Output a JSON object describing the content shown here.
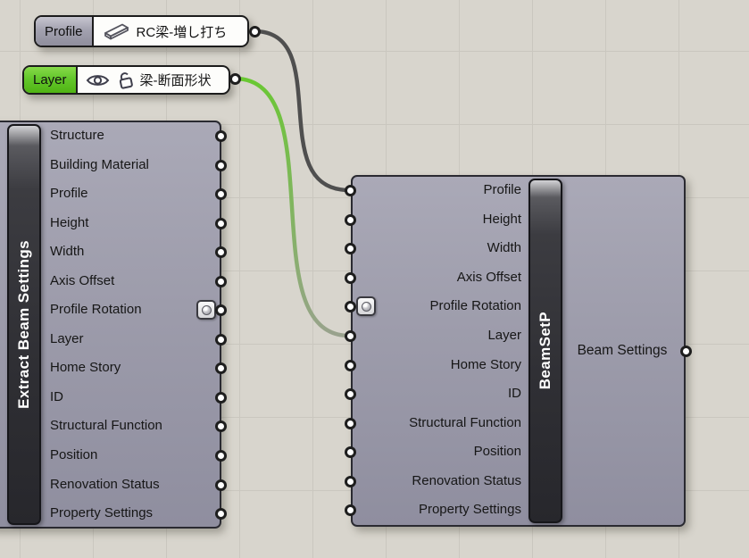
{
  "canvas": {
    "background": "#d8d5cd",
    "grid_line": "#cac7bf"
  },
  "params": {
    "profile": {
      "label": "Profile",
      "value": "RC梁-増し打ち"
    },
    "layer": {
      "label": "Layer",
      "value": "梁-断面形状",
      "selected_color": "#5eb718"
    }
  },
  "components": {
    "extract": {
      "name": "Extract Beam Settings",
      "outputs": [
        "Structure",
        "Building Material",
        "Profile",
        "Height",
        "Width",
        "Axis Offset",
        "Profile Rotation",
        "Layer",
        "Home Story",
        "ID",
        "Structural Function",
        "Position",
        "Renovation Status",
        "Property Settings"
      ]
    },
    "beamsetp": {
      "name": "BeamSetP",
      "inputs": [
        "Profile",
        "Height",
        "Width",
        "Axis Offset",
        "Profile Rotation",
        "Layer",
        "Home Story",
        "ID",
        "Structural Function",
        "Position",
        "Renovation Status",
        "Property Settings"
      ],
      "output_label": "Beam Settings"
    }
  },
  "wires": [
    {
      "name": "profile-wire",
      "from": "Profile param output",
      "to": "BeamSetP Profile input",
      "color": "#4f4f4f"
    },
    {
      "name": "layer-wire",
      "from": "Layer param output",
      "to": "BeamSetP Layer input",
      "color_start": "#68c930",
      "color_end": "#9aa18f"
    }
  ]
}
